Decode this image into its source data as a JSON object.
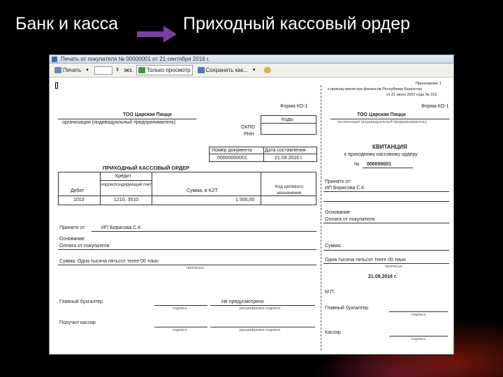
{
  "slide": {
    "title_left": "Банк и касса",
    "title_right": "Приходный кассовый ордер"
  },
  "window": {
    "title": "Печать от покупателя № 00000001 от 21 сентября 2016 г."
  },
  "toolbar": {
    "print_label": "Печать",
    "copies_label": "экз.",
    "readonly_label": "Только просмотр",
    "save_label": "Сохранить как..."
  },
  "order": {
    "form_label": "Форма КО-1",
    "org_name": "ТОО Царская Пицца",
    "org_caption": "организация (индивидуальный предприниматель)",
    "codes_header": "Коды",
    "okpo_label": "ОКПО",
    "rnn_label": "РНН",
    "docnum_header": "Номер документа",
    "docdate_header": "Дата составления",
    "docnum": "00000000001",
    "docdate": "21.09.2016 г.",
    "title": "ПРИХОДНЫЙ КАССОВЫЙ ОРДЕР",
    "debit_header": "Дебет",
    "credit_header": "Кредит",
    "corr_header": "корреспондирующий счет",
    "sum_header": "Сумма, в KZT",
    "target_header": "Код целевого назначения",
    "debit_val": "1010",
    "corr_val": "1210, 3510",
    "sum_val": "1 500,00",
    "received_label": "Принято от",
    "received_val": "ИП Борисова С.К.",
    "basis_label": "Основание",
    "basis_val": "Оплата от покупателя",
    "amount_words": "Сумма: Одна тысяча пятьсот тенге 00 тиын",
    "amount_caption": "прописью",
    "accountant_label": "Главный бухгалтер",
    "accountant_val": "Не предусмотрено",
    "sign_caption": "подпись",
    "decode_caption": "расшифровка подписи",
    "cashier_label": "Получил кассир"
  },
  "receipt": {
    "appendix": "Приложение 1",
    "appendix_line2": "к приказу министра финансов Республики Казахстан",
    "appendix_line3": "от 21 июня 2007 года № 216",
    "form_label": "Форма КО-1",
    "org_name": "ТОО Царская Пицца",
    "org_caption": "организация (индивидуальный предприниматель)",
    "title": "КВИТАНЦИЯ",
    "subtitle": "к приходному кассовому ордеру",
    "num_label": "№",
    "num_val": "000000001",
    "received_label": "Принято от:",
    "received_val": "ИП Борисова С.К.",
    "basis_label": "Основание",
    "basis_val": "Оплата от покупателя",
    "sum_label": "Сумма:",
    "sum_words": "Одна тысяча пятьсот тенге 00 тиын",
    "sum_caption": "прописью",
    "date": "21.09.2016 г.",
    "mp": "М.П.",
    "accountant_label": "Главный бухгалтер",
    "cashier_label": "Кассир",
    "sign_caption": "подпись"
  }
}
